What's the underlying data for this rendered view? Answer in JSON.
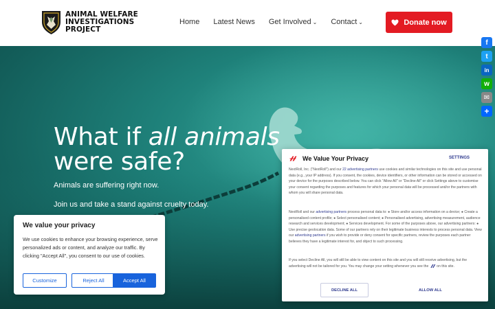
{
  "header": {
    "logo_lines": [
      "ANIMAL WELFARE",
      "INVESTIGATIONS",
      "PROJECT"
    ],
    "nav": [
      {
        "label": "Home",
        "dropdown": false
      },
      {
        "label": "Latest News",
        "dropdown": false
      },
      {
        "label": "Get Involved",
        "dropdown": true
      },
      {
        "label": "Contact",
        "dropdown": true
      }
    ],
    "donate_label": "Donate now"
  },
  "hero": {
    "title_part1": "What if ",
    "title_em": "all animals",
    "title_line2": "were safe?",
    "sub1": "Animals are suffering right now.",
    "sub2": "Join us and take a stand against cruelty today."
  },
  "social": [
    {
      "icon": "facebook-icon",
      "color": "#1877f2",
      "glyph": "f"
    },
    {
      "icon": "twitter-icon",
      "color": "#1da1f2",
      "glyph": "t"
    },
    {
      "icon": "linkedin-icon",
      "color": "#0a66c2",
      "glyph": "in"
    },
    {
      "icon": "whatsapp-icon",
      "color": "#12af0a",
      "glyph": "w"
    },
    {
      "icon": "email-icon",
      "color": "#888888",
      "glyph": "✉"
    },
    {
      "icon": "share-icon",
      "color": "#0166ff",
      "glyph": "+"
    }
  ],
  "cookie_banner": {
    "title": "We value your privacy",
    "text": "We use cookies to enhance your browsing experience, serve personalized ads or content, and analyze our traffic. By clicking \"Accept All\", you consent to our use of cookies.",
    "customize": "Customize",
    "reject": "Reject All",
    "accept": "Accept All"
  },
  "nextroll": {
    "title": "We Value Your Privacy",
    "settings": "SETTINGS",
    "p1_a": "NextRoll, Inc. (\"NextRoll\") and our ",
    "p1_link": "22 advertising partners",
    "p1_b": " use cookies and similar technologies on this site and use personal data (e.g., your IP address). If you consent, the cookies, device identifiers, or other information can be stored or accessed on your device for the purposes described below. You can click \"Allow All\" or \"Decline All\" or click Settings above to customise your consent regarding the purposes and features for which your personal data will be processed and/or the partners with whom you will share personal data.",
    "p2_a": "NextRoll and our ",
    "p2_link": "advertising partners",
    "p2_b": " process personal data to: ● Store and/or access information on a device; ● Create a personalised content profile; ● Select personalised content; ● Personalised advertising, advertising measurement, audience research and services development; ● Services development. For some of the purposes above, our advertising partners: ● Use precise geolocation data. Some of our partners rely on their legitimate business interests to process personal data. View our ",
    "p2_link2": "advertising partners",
    "p2_c": " if you wish to provide or deny consent for specific partners, review the purposes each partner believes they have a legitimate interest for, and object to such processing.",
    "p3_a": "If you select Decline All, you will still be able to view content on this site and you will still receive advertising, but the advertising will not be tailored for you. You may change your setting whenever you see the",
    "p3_b": " on this site.",
    "decline": "DECLINE ALL",
    "allow": "ALLOW ALL"
  },
  "colors": {
    "accent_red": "#e31b23",
    "cookie_blue": "#1863dc",
    "nextroll_navy": "#2f3a8f",
    "hero_teal": "#1e8079"
  }
}
